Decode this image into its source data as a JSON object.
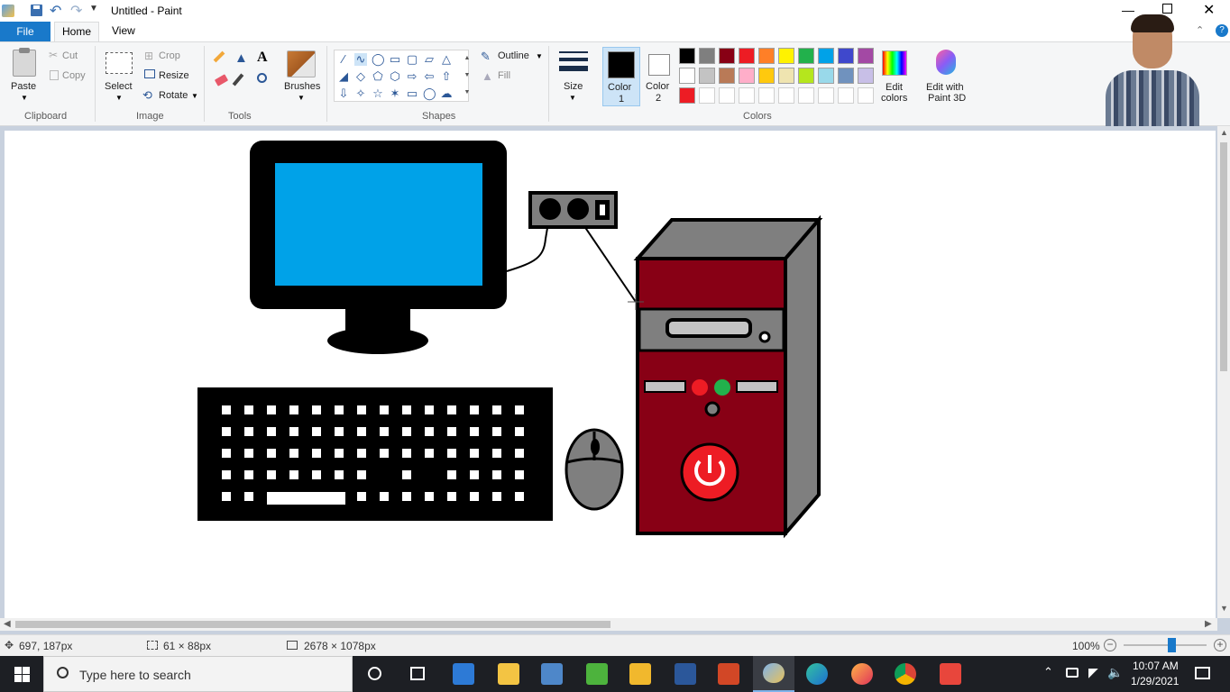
{
  "titlebar": {
    "title": "Untitled - Paint"
  },
  "menu": {
    "file": "File",
    "home": "Home",
    "view": "View"
  },
  "clipboard": {
    "paste": "Paste",
    "cut": "Cut",
    "copy": "Copy",
    "group": "Clipboard"
  },
  "image": {
    "select": "Select",
    "crop": "Crop",
    "resize": "Resize",
    "rotate": "Rotate",
    "group": "Image"
  },
  "tools": {
    "group": "Tools",
    "text_glyph": "A"
  },
  "brushes": {
    "label": "Brushes"
  },
  "shapes": {
    "outline": "Outline",
    "fill": "Fill",
    "group": "Shapes"
  },
  "size": {
    "label": "Size"
  },
  "colors": {
    "color1": "Color 1",
    "color1_line1": "Color",
    "color1_line2": "1",
    "color2": "Color 2",
    "color2_line1": "Color",
    "color2_line2": "2",
    "group": "Colors",
    "edit_line1": "Edit",
    "edit_line2": "colors",
    "paint3d_line1": "Edit with",
    "paint3d_line2": "Paint 3D",
    "palette_row1": [
      "#000000",
      "#7f7f7f",
      "#880015",
      "#ed1c24",
      "#ff7f27",
      "#fff200",
      "#22b14c",
      "#00a2e8",
      "#3f48cc",
      "#a349a4"
    ],
    "palette_row2": [
      "#ffffff",
      "#c3c3c3",
      "#b97a57",
      "#ffaec9",
      "#ffc90e",
      "#efe4b0",
      "#b5e61d",
      "#99d9ea",
      "#7092be",
      "#c8bfe7"
    ],
    "palette_row3": [
      "#ed1c24",
      "#ffffff",
      "#ffffff",
      "#ffffff",
      "#ffffff",
      "#ffffff",
      "#ffffff",
      "#ffffff",
      "#ffffff",
      "#ffffff"
    ]
  },
  "status": {
    "cursor": "697, 187px",
    "selection": "61 × 88px",
    "canvas_size": "2678 × 1078px",
    "zoom": "100%",
    "zoom_level": 0.58
  },
  "taskbar": {
    "search_placeholder": "Type here to search",
    "time": "10:07 AM",
    "date": "1/29/2021"
  }
}
